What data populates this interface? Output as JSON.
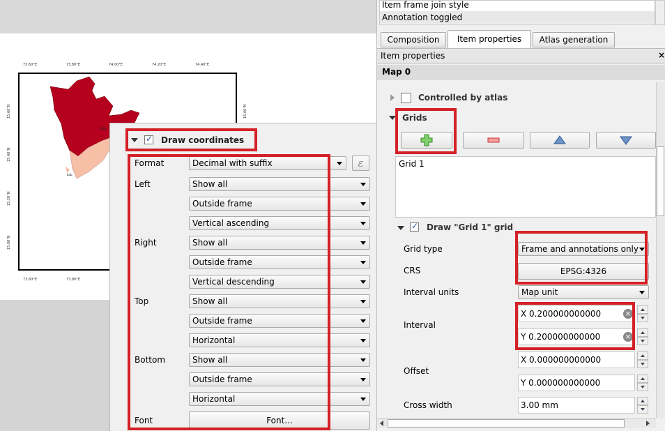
{
  "history": {
    "items": [
      "Item frame join style",
      "Annotation toggled"
    ]
  },
  "tabs": [
    {
      "label": "Composition"
    },
    {
      "label": "Item properties"
    },
    {
      "label": "Atlas generation"
    }
  ],
  "item_properties_header": "Item properties",
  "map_title": "Map 0",
  "controlled_by_atlas": "Controlled by atlas",
  "grids_label": "Grids",
  "grid_list": [
    "Grid 1"
  ],
  "draw_grid_label": "Draw \"Grid 1\" grid",
  "grid": {
    "grid_type_label": "Grid type",
    "grid_type_value": "Frame and annotations only",
    "crs_label": "CRS",
    "crs_value": "EPSG:4326",
    "interval_units_label": "Interval units",
    "interval_units_value": "Map unit",
    "interval_label": "Interval",
    "interval_x": "X 0.200000000000",
    "interval_y": "Y 0.200000000000",
    "offset_label": "Offset",
    "offset_x": "X 0.000000000000",
    "offset_y": "Y 0.000000000000",
    "cross_width_label": "Cross width",
    "cross_width_value": "3.00 mm"
  },
  "coords": {
    "title": "Draw coordinates",
    "format_label": "Format",
    "format_value": "Decimal with suffix",
    "left_label": "Left",
    "left_values": [
      "Show all",
      "Outside frame",
      "Vertical ascending"
    ],
    "right_label": "Right",
    "right_values": [
      "Show all",
      "Outside frame",
      "Vertical descending"
    ],
    "top_label": "Top",
    "top_values": [
      "Show all",
      "Outside frame",
      "Horizontal"
    ],
    "bottom_label": "Bottom",
    "bottom_values": [
      "Show all",
      "Outside frame",
      "Horizontal"
    ],
    "font_label": "Font",
    "font_button": "Font..."
  },
  "map_ticks": {
    "top": [
      "73.60°E",
      "73.80°E",
      "74.00°E",
      "74.20°E",
      "74.40°E"
    ],
    "bottom": [
      "73.60°E",
      "73.80°E"
    ],
    "left": [
      "15.60°N",
      "15.40°N",
      "15.20°N",
      "15.00°N"
    ],
    "right": [
      "15.60°N"
    ]
  },
  "colors": {
    "highlight": "#d42027",
    "region_dark": "#b5001e",
    "region_light": "#f6bfa6"
  }
}
